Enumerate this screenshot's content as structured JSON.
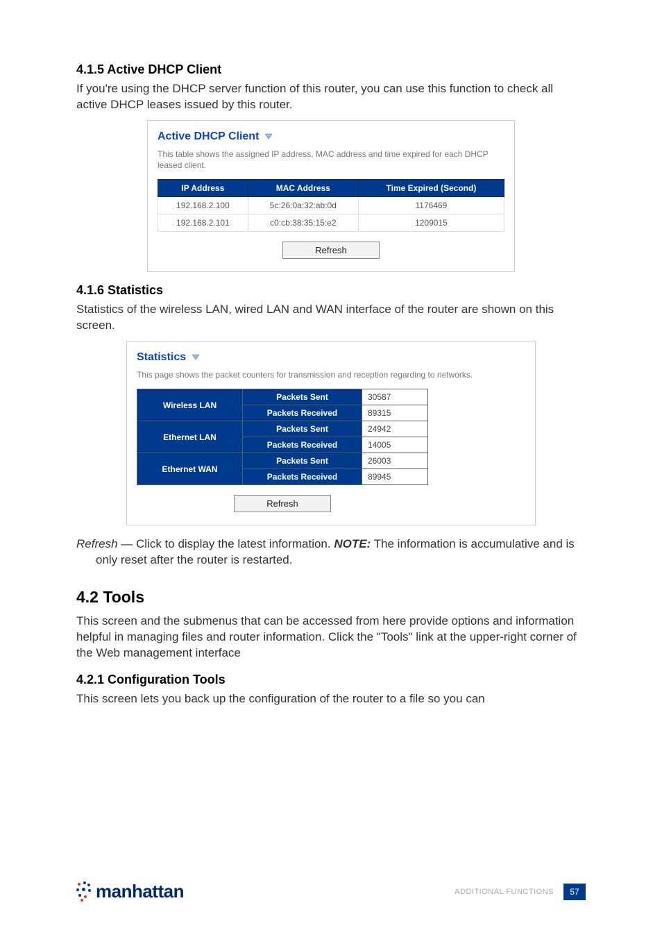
{
  "section_415": {
    "heading": "4.1.5  Active DHCP Client",
    "para": "If you're using the DHCP server function of this router, you can use this function to check all active DHCP leases issued by this router."
  },
  "dhcp_panel": {
    "title": "Active DHCP Client",
    "desc": "This table shows the assigned IP address, MAC address and time expired for each DHCP leased client.",
    "headers": {
      "ip": "IP Address",
      "mac": "MAC Address",
      "time": "Time Expired (Second)"
    },
    "rows": [
      {
        "ip": "192.168.2.100",
        "mac": "5c:26:0a:32:ab:0d",
        "time": "1176469"
      },
      {
        "ip": "192.168.2.101",
        "mac": "c0:cb:38:35:15:e2",
        "time": "1209015"
      }
    ],
    "refresh": "Refresh"
  },
  "section_416": {
    "heading": "4.1.6  Statistics",
    "para": "Statistics of the wireless LAN, wired LAN and WAN interface of the router are shown on this screen."
  },
  "stats_panel": {
    "title": "Statistics",
    "desc": "This page shows the packet counters for transmission and reception regarding to networks.",
    "labels": {
      "wlan": "Wireless LAN",
      "elan": "Ethernet LAN",
      "ewan": "Ethernet WAN",
      "sent": "Packets Sent",
      "recv": "Packets Received"
    },
    "values": {
      "wlan_sent": "30587",
      "wlan_recv": "89315",
      "elan_sent": "24942",
      "elan_recv": "14005",
      "ewan_sent": "26003",
      "ewan_recv": "89945"
    },
    "refresh": "Refresh"
  },
  "refresh_note": {
    "term": "Refresh",
    "sep": " — ",
    "body1": "Click to display the latest information. ",
    "note_label": "NOTE:",
    "body2": " The information is accumulative and is only reset after the router is restarted."
  },
  "section_42": {
    "heading": "4.2  Tools",
    "para": "This screen and the submenus that can be accessed from here provide options and information helpful in managing files and router information. Click the \"Tools\" link at the upper-right corner of the Web management interface"
  },
  "section_421": {
    "heading": "4.2.1  Configuration Tools",
    "para": "This screen lets you back up the configuration of the router to a file so you can"
  },
  "footer": {
    "logo_text": "manhattan",
    "section_label": "ADDITIONAL FUNCTIONS",
    "page": "57"
  }
}
